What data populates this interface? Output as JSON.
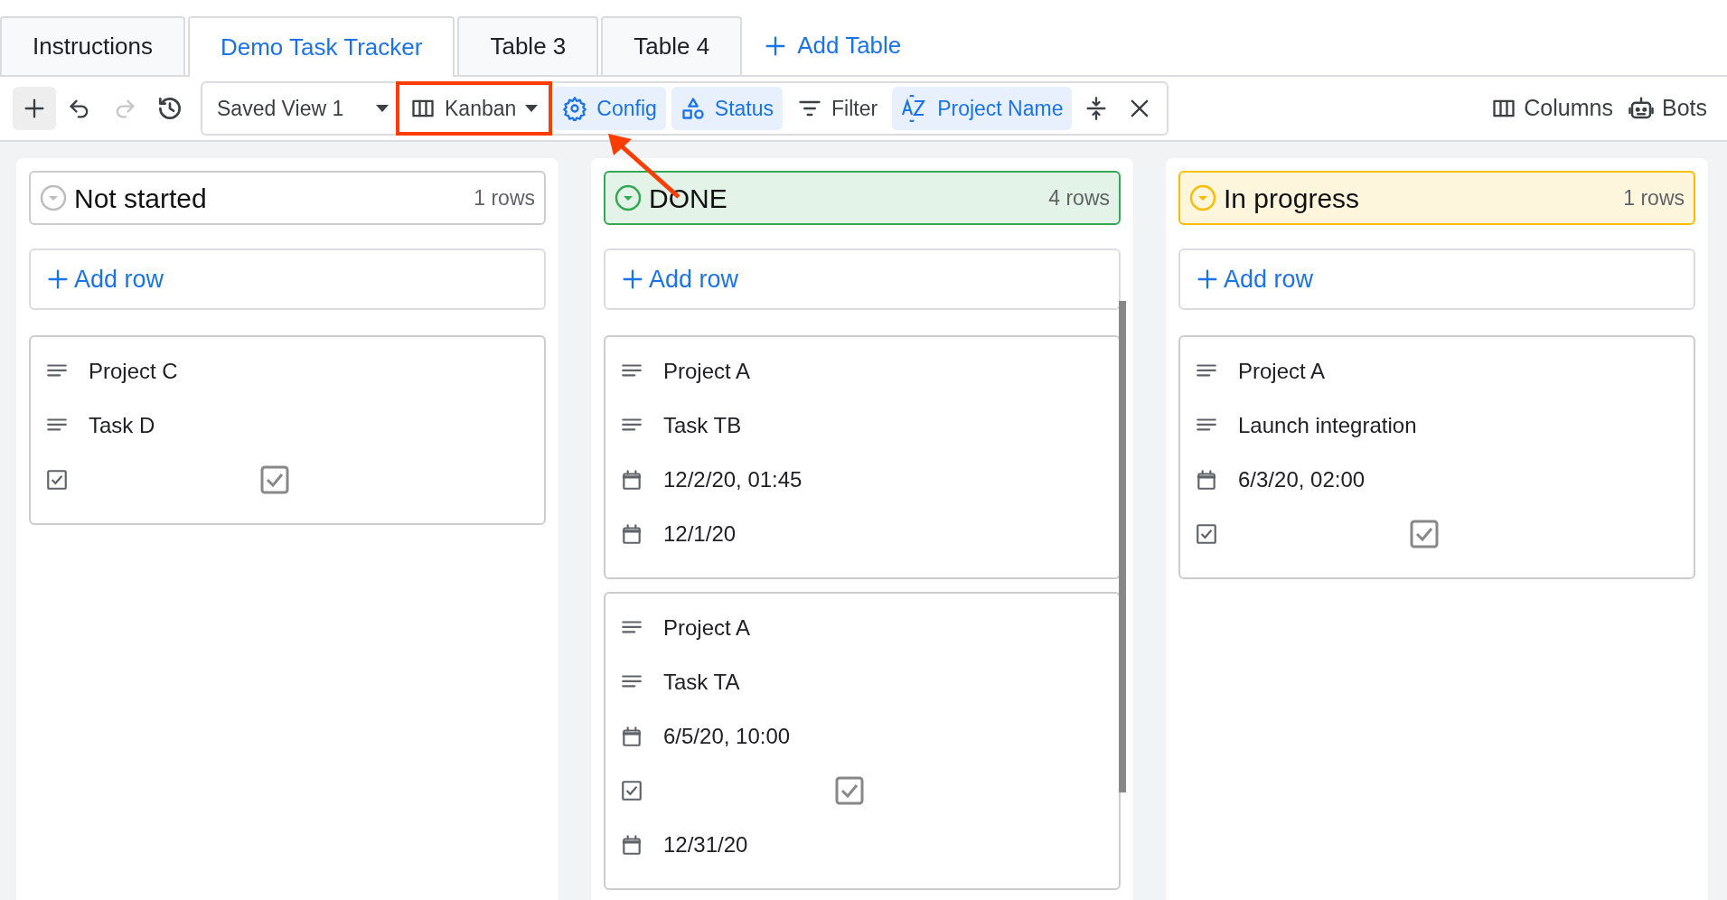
{
  "tabs": [
    {
      "label": "Instructions",
      "selected": false
    },
    {
      "label": "Demo Task Tracker",
      "selected": true
    },
    {
      "label": "Table 3",
      "selected": false
    },
    {
      "label": "Table 4",
      "selected": false
    }
  ],
  "add_table": "Add Table",
  "toolbar": {
    "icon_buttons": [
      {
        "disabled": false
      },
      {
        "disabled": false
      },
      {
        "disabled": true
      },
      {
        "disabled": false
      }
    ],
    "saved_view": "Saved View 1",
    "view_type": {
      "label": "Kanban",
      "highlighted": true
    },
    "chips": [
      {
        "label": "Config",
        "active": true,
        "pointed_at": true
      },
      {
        "label": "Status",
        "active": true,
        "pointed_at": false
      },
      {
        "label": "Filter",
        "active": false,
        "pointed_at": false
      },
      {
        "label": "Project Name",
        "active": true,
        "pointed_at": false
      }
    ],
    "right": [
      "Columns",
      "Bots"
    ]
  },
  "columns": [
    {
      "title": "Not started",
      "count": "1 rows",
      "color": "#bdbdbd",
      "tinted": false,
      "add_row": "Add row",
      "cards": [
        {
          "fields": [
            {
              "kind": "text",
              "value": "Project C"
            },
            {
              "kind": "text",
              "value": "Task D"
            },
            {
              "kind": "checkbox",
              "checked": true
            }
          ]
        }
      ]
    },
    {
      "title": "DONE",
      "count": "4 rows",
      "color": "#34a853",
      "tinted": true,
      "add_row": "Add row",
      "cards": [
        {
          "fields": [
            {
              "kind": "text",
              "value": "Project A"
            },
            {
              "kind": "text",
              "value": "Task TB"
            },
            {
              "kind": "date",
              "value": "12/2/20, 01:45"
            },
            {
              "kind": "date",
              "value": "12/1/20"
            }
          ]
        },
        {
          "fields": [
            {
              "kind": "text",
              "value": "Project A"
            },
            {
              "kind": "text",
              "value": "Task TA"
            },
            {
              "kind": "date",
              "value": "6/5/20, 10:00"
            },
            {
              "kind": "checkbox",
              "checked": true
            },
            {
              "kind": "date",
              "value": "12/31/20"
            }
          ]
        }
      ]
    },
    {
      "title": "In progress",
      "count": "1 rows",
      "color": "#fbbc04",
      "tinted": true,
      "add_row": "Add row",
      "cards": [
        {
          "fields": [
            {
              "kind": "text",
              "value": "Project A"
            },
            {
              "kind": "text",
              "value": "Launch integration"
            },
            {
              "kind": "date",
              "value": "6/3/20, 02:00"
            },
            {
              "kind": "checkbox",
              "checked": true
            }
          ]
        }
      ]
    }
  ]
}
